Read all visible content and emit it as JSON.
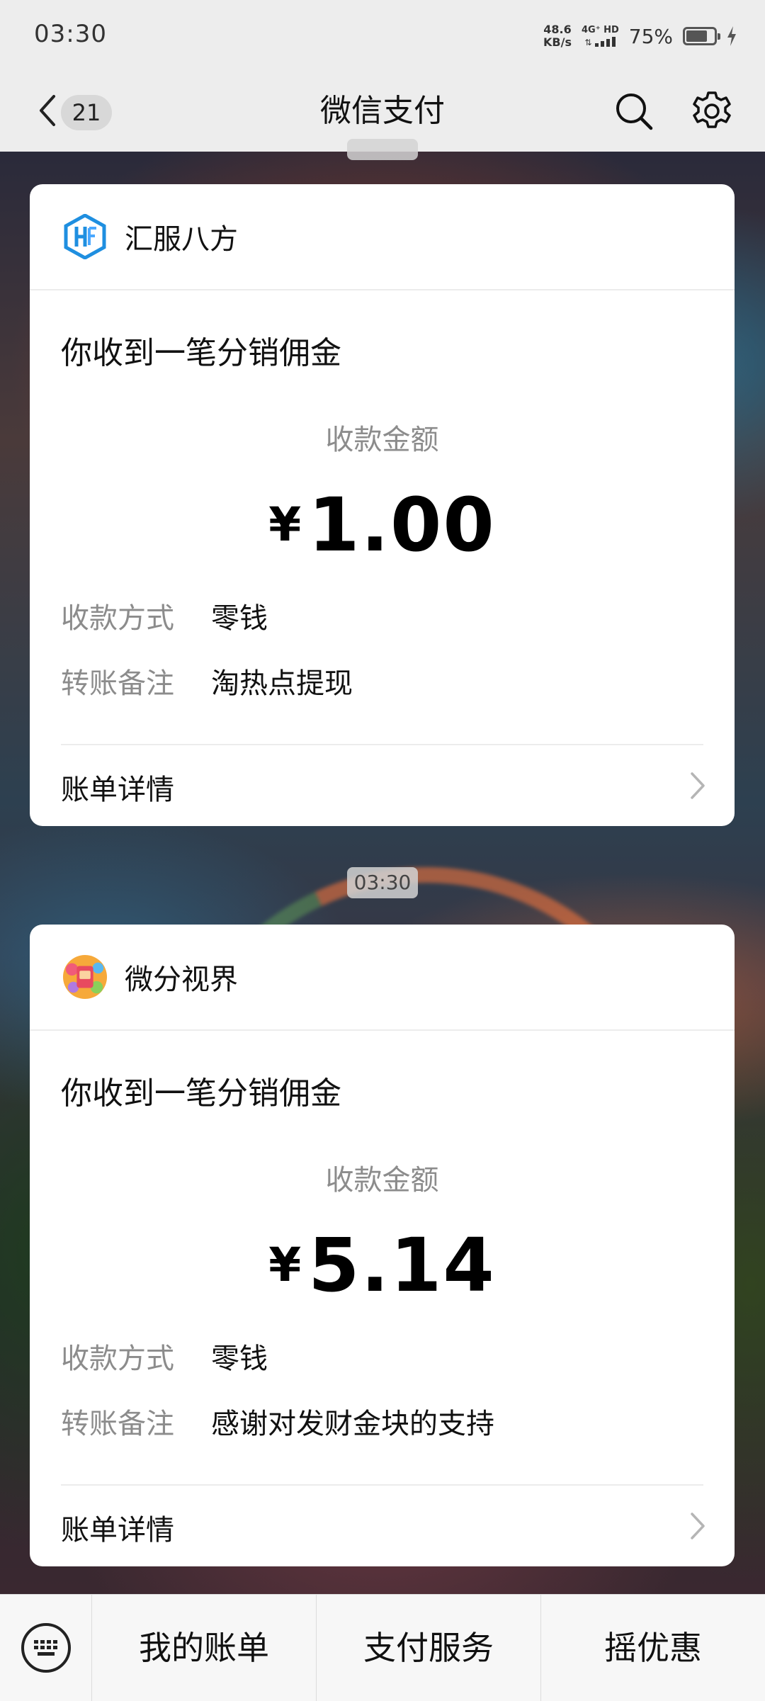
{
  "status_bar": {
    "time": "03:30",
    "net_speed_value": "48.6",
    "net_speed_unit": "KB/s",
    "network_type": "4G⁺ HD",
    "battery_percent": "75%",
    "battery_level": 0.75
  },
  "nav": {
    "unread_count": "21",
    "title": "微信支付"
  },
  "messages": [
    {
      "timestamp": "",
      "merchant": "汇服八方",
      "title": "你收到一笔分销佣金",
      "amount_label": "收款金额",
      "currency": "¥",
      "amount": "1.00",
      "method_label": "收款方式",
      "method_value": "零钱",
      "note_label": "转账备注",
      "note_value": "淘热点提现",
      "details_label": "账单详情"
    },
    {
      "timestamp": "03:30",
      "merchant": "微分视界",
      "title": "你收到一笔分销佣金",
      "amount_label": "收款金额",
      "currency": "¥",
      "amount": "5.14",
      "method_label": "收款方式",
      "method_value": "零钱",
      "note_label": "转账备注",
      "note_value": "感谢对发财金块的支持",
      "details_label": "账单详情"
    }
  ],
  "bottom_menu": {
    "items": [
      "我的账单",
      "支付服务",
      "摇优惠"
    ]
  },
  "icons": {
    "back": "back-arrow-icon",
    "search": "search-icon",
    "settings": "gear-icon",
    "keyboard": "keyboard-icon",
    "chevron": "chevron-right-icon"
  },
  "colors": {
    "header_bg": "#ededed",
    "card_bg": "#ffffff",
    "muted_text": "#8c8c8c",
    "logo_blue": "#1f8fe0"
  }
}
